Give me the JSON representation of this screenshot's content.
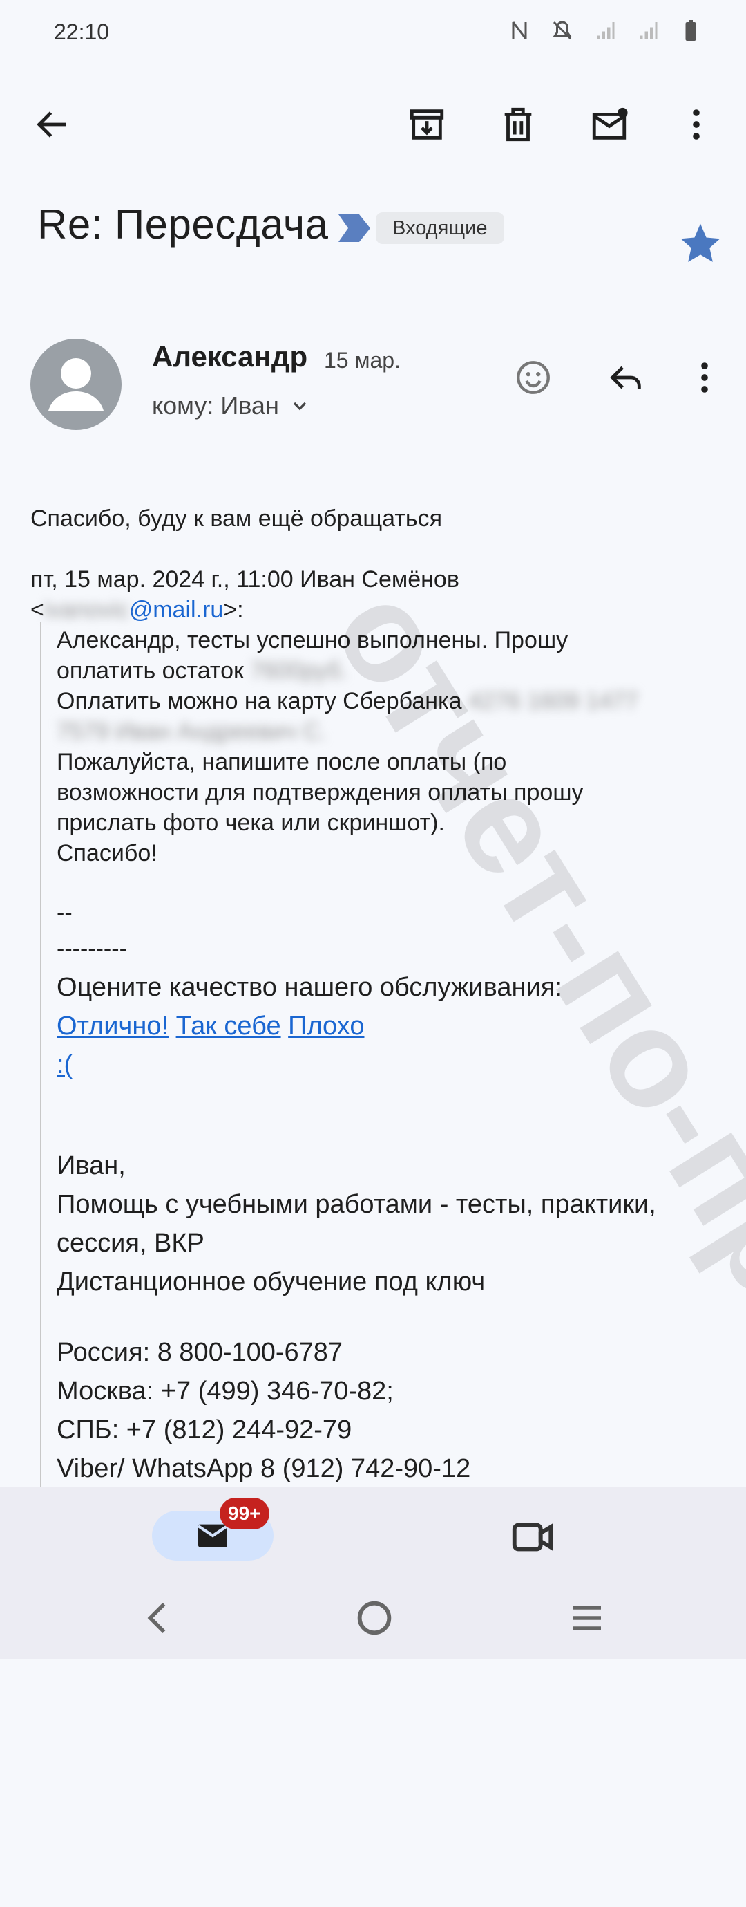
{
  "status_bar": {
    "time": "22:10"
  },
  "email": {
    "subject": "Re: Пересдача",
    "label": "Входящие",
    "sender": "Александр",
    "date": "15 мар.",
    "recipient": "кому: Иван",
    "reply_line": "Спасибо, буду к вам ещё обращаться",
    "quote_header_1": "пт, 15 мар. 2024 г., 11:00 Иван Семёнов",
    "quote_header_2a": "<",
    "quote_header_blur": "ivanovic",
    "quote_header_link": "@mail.ru",
    "quote_header_2b": ">:",
    "q1": "Александр, тесты успешно выполнены. Прошу",
    "q2": "оплатить остаток",
    "q2_blur": "7600руб.",
    "q3": "Оплатить можно на карту Сбербанка",
    "q3_blur": "4276 1609 1477",
    "q4_blur": "7579 Иван Андреевич С.",
    "q5": "Пожалуйста, напишите после оплаты (по",
    "q6": "возможности для подтверждения оплаты прошу",
    "q7": "прислать фото чека или скриншот).",
    "q8": "Спасибо!",
    "q9": "--",
    "q10": "---------",
    "rate": "Оцените качество нашего обслуживания:",
    "rate_links": [
      "Отлично!",
      "Так себе",
      "Плохо",
      ":("
    ],
    "sig1": "Иван,",
    "sig2": "Помощь с учебными работами - тесты, практики,",
    "sig3": "сессия, ВКР",
    "sig4": "Дистанционное обучение под ключ",
    "phone1": "Россия: 8 800-100-6787",
    "phone2": "Москва: +7 (499) 346-70-82;",
    "phone3": "СПБ: +7 (812) 244-92-79",
    "phone4": "Viber/ WhatsApp 8 (912) 742-90-12"
  },
  "watermark": "отчет-по-практике.рф",
  "bottom_nav": {
    "mail_badge": "99+"
  },
  "colors": {
    "star": "#4a78c0",
    "link": "#1a66d1",
    "badge": "#c5221f",
    "label_arrow": "#5a7fc0"
  }
}
